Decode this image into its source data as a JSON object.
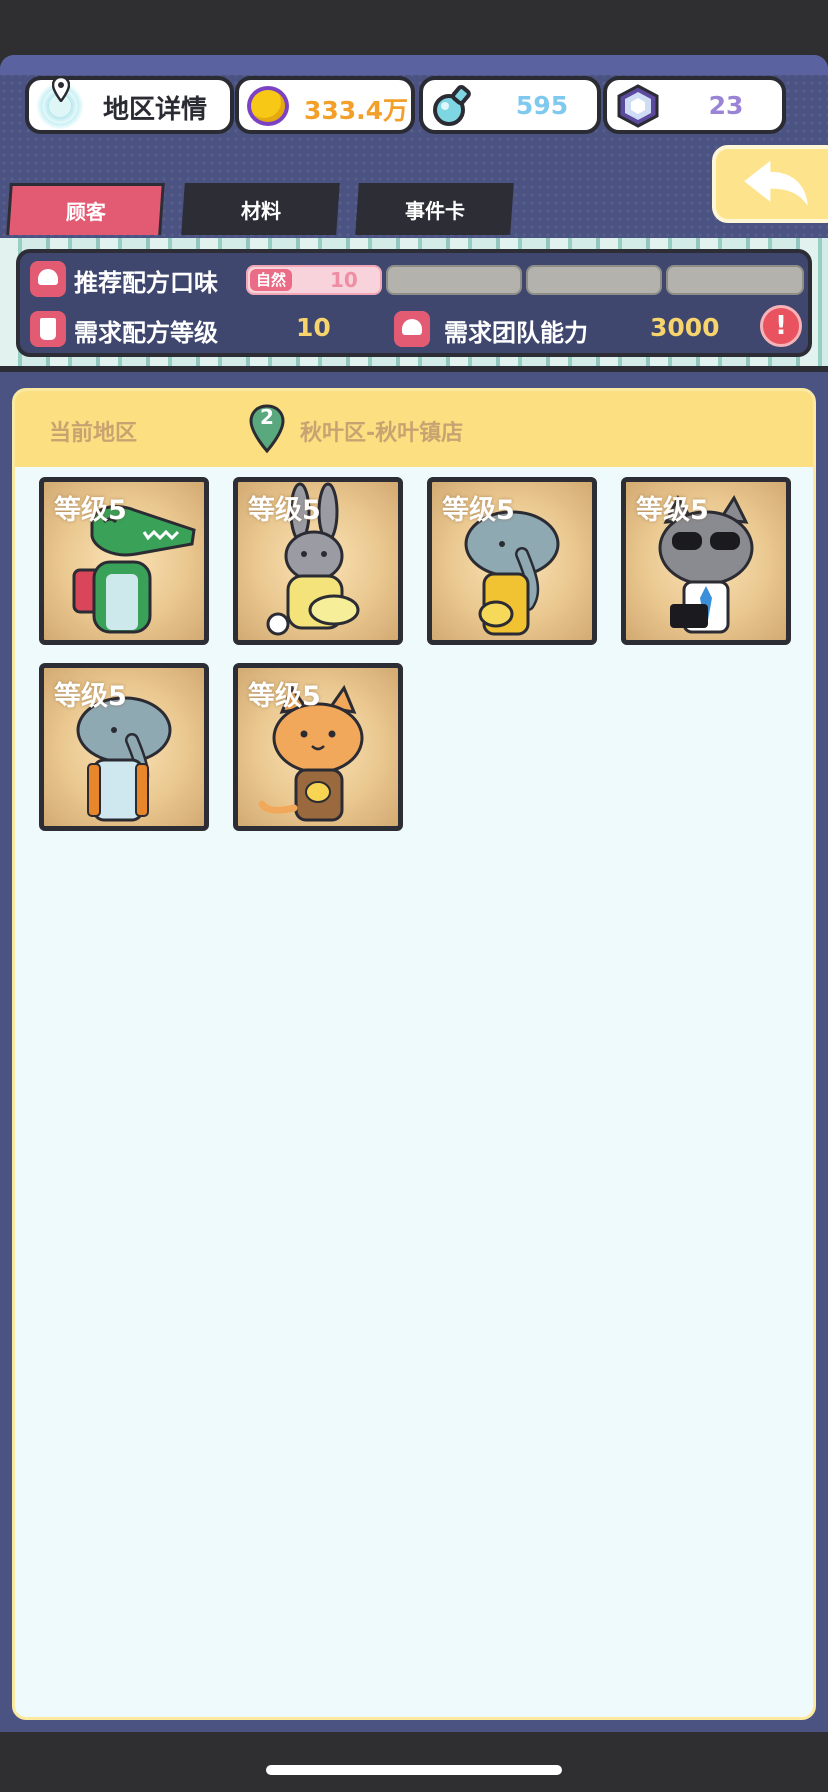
{
  "header": {
    "region_button": "地区详情",
    "coins": "333.4万",
    "potions": "595",
    "gems": "23"
  },
  "tabs": [
    {
      "label": "顾客",
      "active": true
    },
    {
      "label": "材料",
      "active": false
    },
    {
      "label": "事件卡",
      "active": false
    }
  ],
  "requirements": {
    "flavor_label": "推荐配方口味",
    "flavor_tag": "自然",
    "flavor_value": "10",
    "recipe_level_label": "需求配方等级",
    "recipe_level_value": "10",
    "team_label": "需求团队能力",
    "team_value": "3000",
    "alert_symbol": "!"
  },
  "region": {
    "current_label": "当前地区",
    "marker_number": "2",
    "name": "秋叶区-秋叶镇店"
  },
  "customers": [
    {
      "level": "等级5",
      "animal": "crocodile"
    },
    {
      "level": "等级5",
      "animal": "rabbit"
    },
    {
      "level": "等级5",
      "animal": "elephant"
    },
    {
      "level": "等级5",
      "animal": "cat-sunglasses"
    },
    {
      "level": "等级5",
      "animal": "elephant"
    },
    {
      "level": "等级5",
      "animal": "orange-cat"
    }
  ],
  "colors": {
    "header_bg": "#4b5382",
    "active_tab": "#e35b72",
    "region_bar": "#fbdf80",
    "content_bg": "#eefafc",
    "accent_yellow": "#f7d46c"
  }
}
